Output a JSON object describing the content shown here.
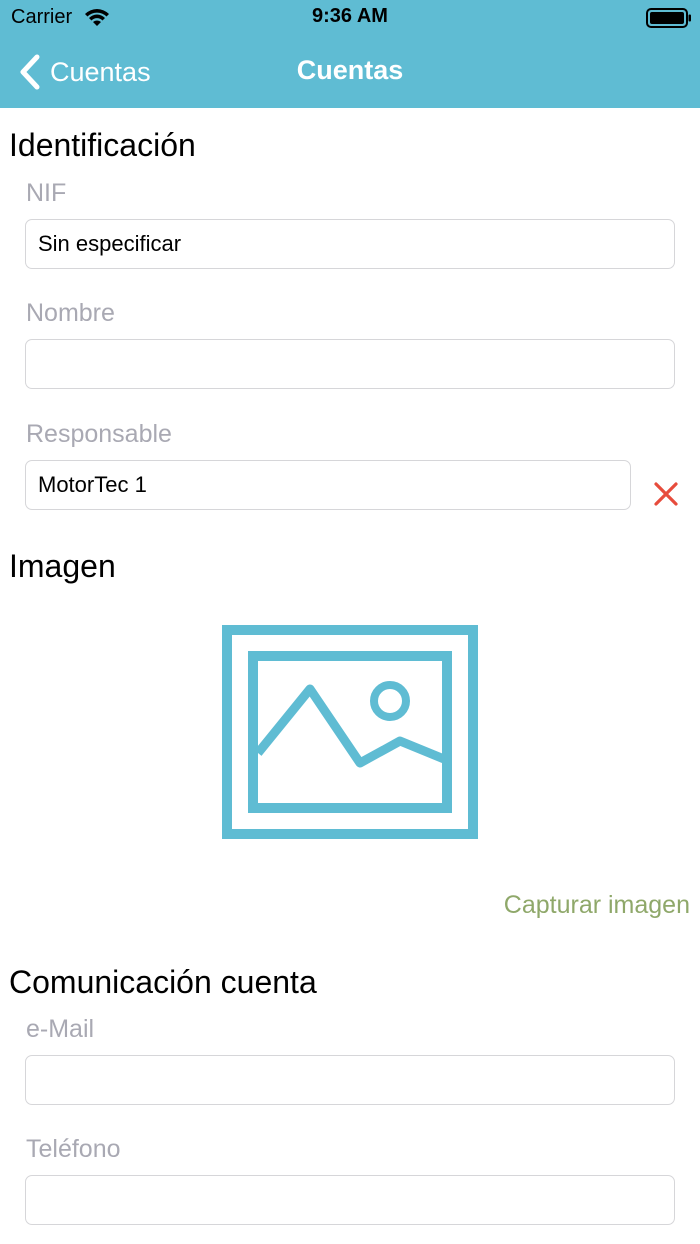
{
  "status_bar": {
    "carrier": "Carrier",
    "time": "9:36 AM"
  },
  "nav": {
    "back_label": "Cuentas",
    "title": "Cuentas",
    "bar_color": "#5fbcd3"
  },
  "identificacion": {
    "title": "Identificación",
    "nif": {
      "label": "NIF",
      "value": "Sin especificar"
    },
    "nombre": {
      "label": "Nombre",
      "value": ""
    },
    "responsable": {
      "label": "Responsable",
      "value": "MotorTec 1"
    }
  },
  "imagen": {
    "title": "Imagen",
    "placeholder_icon": "image-icon",
    "capture_label": "Capturar imagen",
    "icon_color": "#5fbcd3",
    "link_color": "#8fa86a"
  },
  "comunicacion": {
    "title": "Comunicación cuenta",
    "email": {
      "label": "e-Mail",
      "value": ""
    },
    "telefono": {
      "label": "Teléfono",
      "value": ""
    }
  },
  "colors": {
    "label": "#a9a9b3",
    "clear_icon": "#e74c3c"
  }
}
